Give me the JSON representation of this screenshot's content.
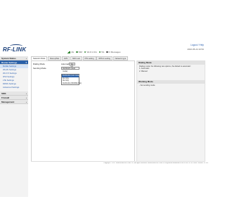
{
  "header": {
    "logo_text": "RF-LINK",
    "logout": "Logout / Help",
    "datetime": "2022-05-24 10:52",
    "status": [
      {
        "label": "4G",
        "icon": "signal-bars-icon",
        "color": "#3a8a3a"
      },
      {
        "label": "SIM",
        "icon": "sim-icon",
        "color": "#3a8a3a"
      },
      {
        "label": "Wi-Fi 2.4G",
        "icon": "wifi-icon",
        "color": "#3a8a3a"
      },
      {
        "label": "5G",
        "icon": "wifi-5g-icon",
        "color": "#3a8a3a"
      },
      {
        "label": "0 Messages",
        "icon": "message-icon",
        "color": "#666666"
      }
    ]
  },
  "sidebar": {
    "sections": [
      {
        "label": "System Status",
        "active": false,
        "items": []
      },
      {
        "label": "Router Settings",
        "active": true,
        "items": [
          {
            "label": "Mobile Settings",
            "selected": true
          },
          {
            "label": "WLAN Settings",
            "selected": false
          },
          {
            "label": "Wi-Fi 5 Settings",
            "selected": false
          },
          {
            "label": "IPv6 Settings",
            "selected": false
          },
          {
            "label": "LTE Settings",
            "selected": false
          },
          {
            "label": "DDNS Settings",
            "selected": false
          },
          {
            "label": "Advanced Settings",
            "selected": false
          }
        ]
      },
      {
        "label": "SMS",
        "active": false,
        "items": []
      },
      {
        "label": "Firewall",
        "active": false,
        "items": []
      },
      {
        "label": "Management",
        "active": false,
        "items": []
      }
    ]
  },
  "tabs": [
    {
      "label": "Network Mode",
      "active": true
    },
    {
      "label": "Dial-up/Net",
      "active": false
    },
    {
      "label": "APN",
      "active": false
    },
    {
      "label": "SIM Lock",
      "active": false
    },
    {
      "label": "PIN setting",
      "active": false
    },
    {
      "label": "IP/Port setting",
      "active": false
    },
    {
      "label": "Network type",
      "active": false
    }
  ],
  "form": {
    "dialing_mode_label": "Dialing Mode",
    "dialing_mode_value": "Automatic",
    "dialing_mode_button": "Set Up",
    "sending_mode_label": "Sending Mode",
    "sending_mode_value": "4G/3G/2G (Auto mode)",
    "dropdown_options": [
      {
        "label": "4G/3G/2G (Auto mode)",
        "highlighted": true
      },
      {
        "label": "4G Only",
        "highlighted": false
      },
      {
        "label": "3G Only",
        "highlighted": false
      },
      {
        "label": "4G/3G/2G (WCDMA first)",
        "highlighted": false
      }
    ]
  },
  "help": {
    "dialing_title": "Dialing Mode",
    "dialing_text": "Dialing mode: the following two options, the default is automatic:",
    "dialing_opt1": "1. Automatic",
    "dialing_opt2": "2. Manual",
    "working_title": "Working Mode",
    "working_text": "- Set sending mode"
  },
  "footer": "Copyright © 2017 SHENZHEN RF-LINK Co., All rights reserved. SHENZHEN RF-LINK is a registered trademark of RF-LINK Co. in China. Version: V1.0.0"
}
